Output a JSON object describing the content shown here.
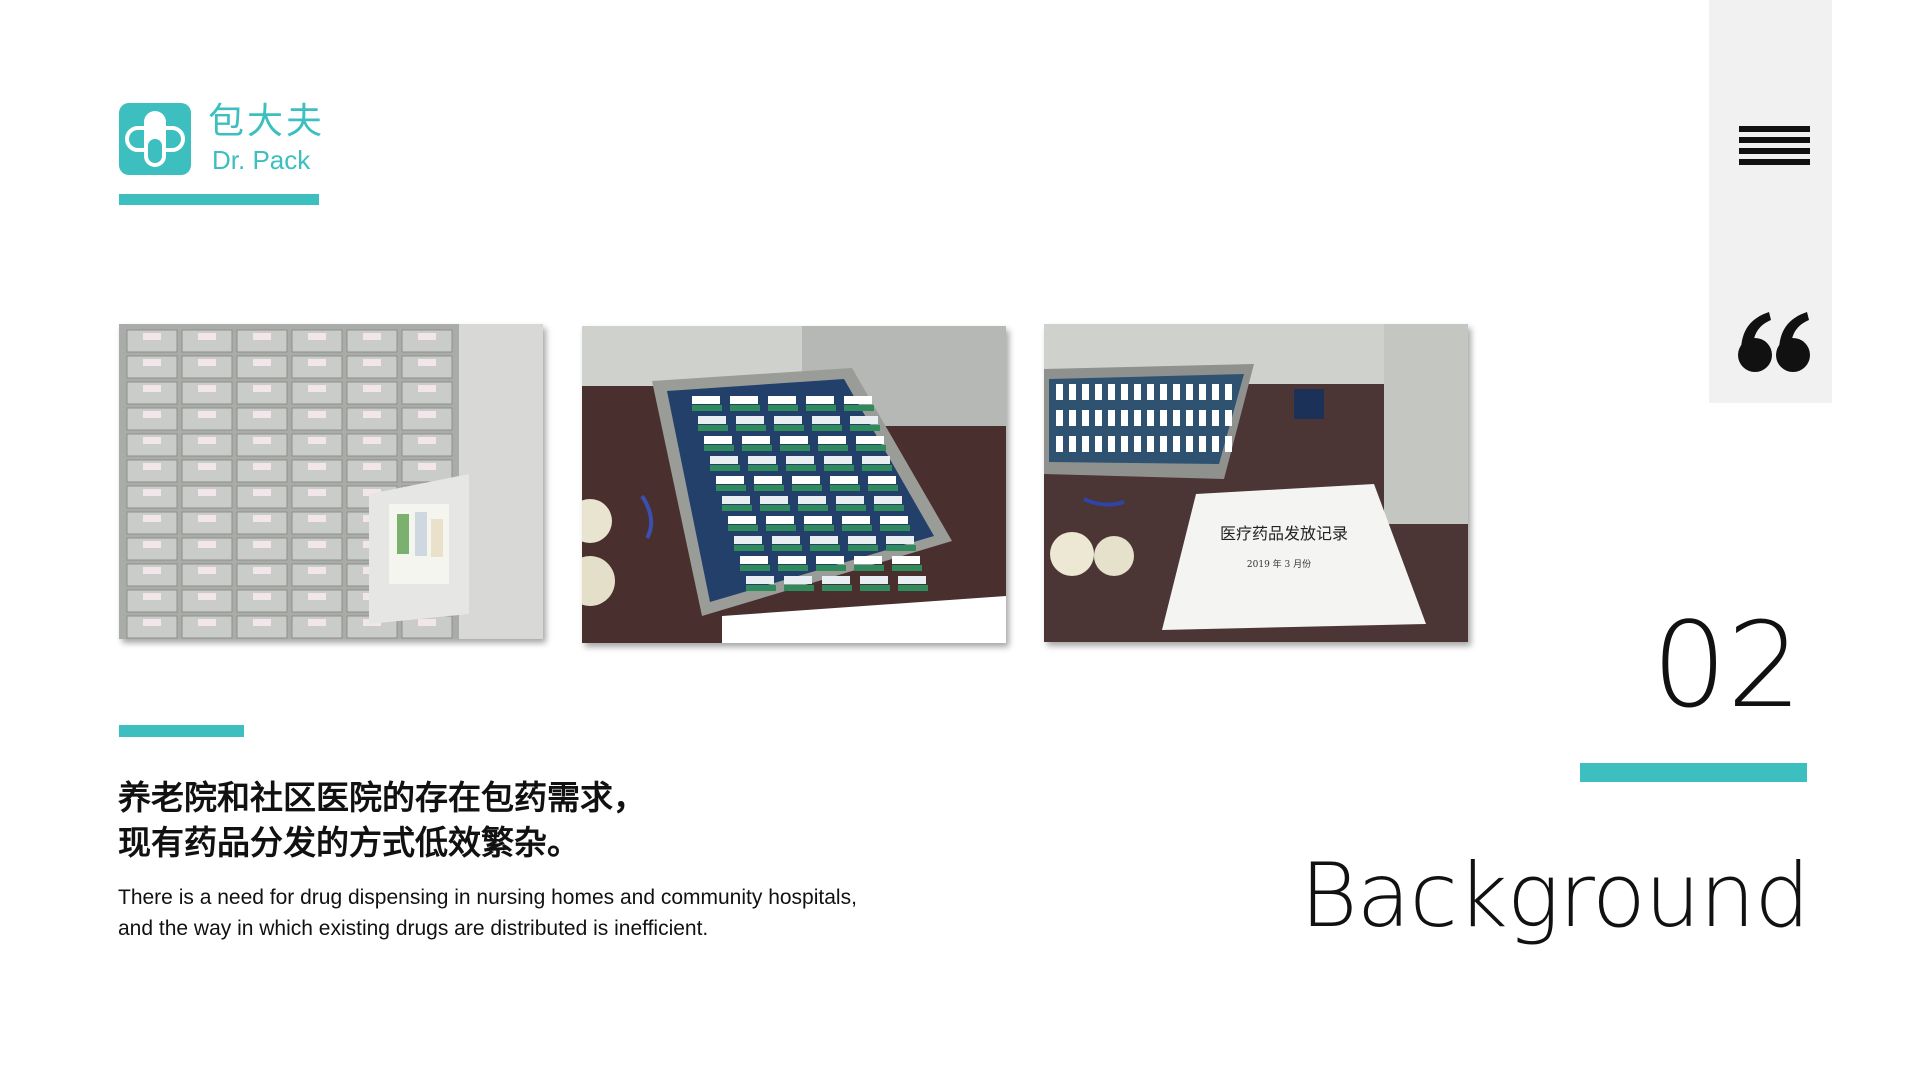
{
  "brand": {
    "name_cn": "包大夫",
    "name_en": "Dr. Pack",
    "accent_color": "#3dbfc0",
    "logo_icon": "capsule-cross-icon"
  },
  "side": {
    "menu_icon": "hamburger-menu-icon",
    "quote_icon": "quote-icon"
  },
  "photos": [
    {
      "subject": "medicine-drawer-cabinet"
    },
    {
      "subject": "medicine-tray"
    },
    {
      "subject": "drug-dispensing-record"
    }
  ],
  "section": {
    "number": "02",
    "title": "Background",
    "heading_cn_line1": "养老院和社区医院的存在包药需求，",
    "heading_cn_line2": "现有药品分发的方式低效繁杂。",
    "body_en_line1": "There is a need for drug dispensing in nursing homes and community hospitals,",
    "body_en_line2": "and the way in which existing drugs are distributed is inefficient."
  },
  "photo_text": {
    "record_title": "医疗药品发放记录",
    "record_subtitle": "2019 年 3 月份"
  }
}
